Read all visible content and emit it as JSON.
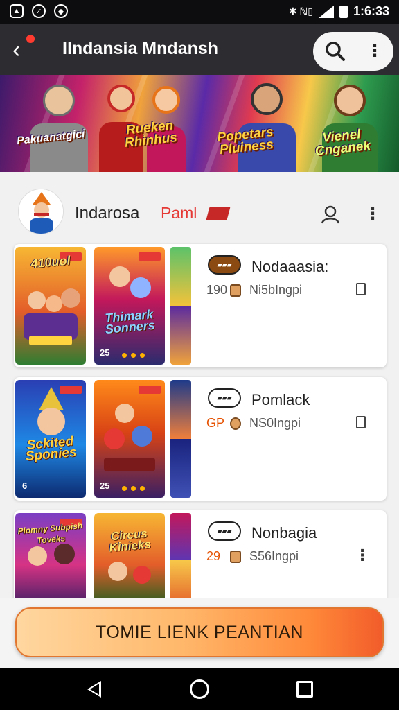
{
  "status_bar": {
    "time": "1:6:33",
    "bluetooth_label": "✱ ℕ▯",
    "icons": [
      "gallery-icon",
      "messenger-icon",
      "shield-icon",
      "bluetooth-icon",
      "signal-icon",
      "battery-icon"
    ]
  },
  "app_bar": {
    "title": "Ilndansia Mndansh",
    "icons": [
      "back-arrow-icon",
      "search-icon",
      "more-vert-icon"
    ]
  },
  "banner": {
    "logos": [
      "Pakuanatgici",
      "Rueken Rhinhus",
      "Popetars Pluiness",
      "Vienel Cnganek"
    ]
  },
  "channel": {
    "name": "Indarosa",
    "tag": "Paml",
    "icons": [
      "flag-icon",
      "user-icon",
      "more-vert-icon"
    ]
  },
  "cards": [
    {
      "thumb1_title": "410uol",
      "thumb2_title": "Thimark Sonners",
      "thumb2_badge": "25",
      "title": "Nodaaasia:",
      "count": "190",
      "subtitle": "Ni5bIngpi",
      "action": "bookmark"
    },
    {
      "thumb1_title": "Sckited Sponies",
      "thumb1_badge": "6",
      "thumb2_badge": "25",
      "title": "Pomlack",
      "count": "GP",
      "subtitle": "NS0Ingpi",
      "action": "bookmark"
    },
    {
      "thumb1_title": "Plomny Subpish Toveks",
      "thumb2_title": "Circus Kinieks",
      "title": "Nonbagia",
      "count": "29",
      "subtitle": "S56Ingpi",
      "action": "more"
    }
  ],
  "cta": {
    "label": "TOMIE LIENK PEANTIAN"
  },
  "colors": {
    "app_bar": "#2d2d31",
    "accent_red": "#e53935",
    "cta_start": "#ffd7a0",
    "cta_end": "#f25c2a"
  }
}
